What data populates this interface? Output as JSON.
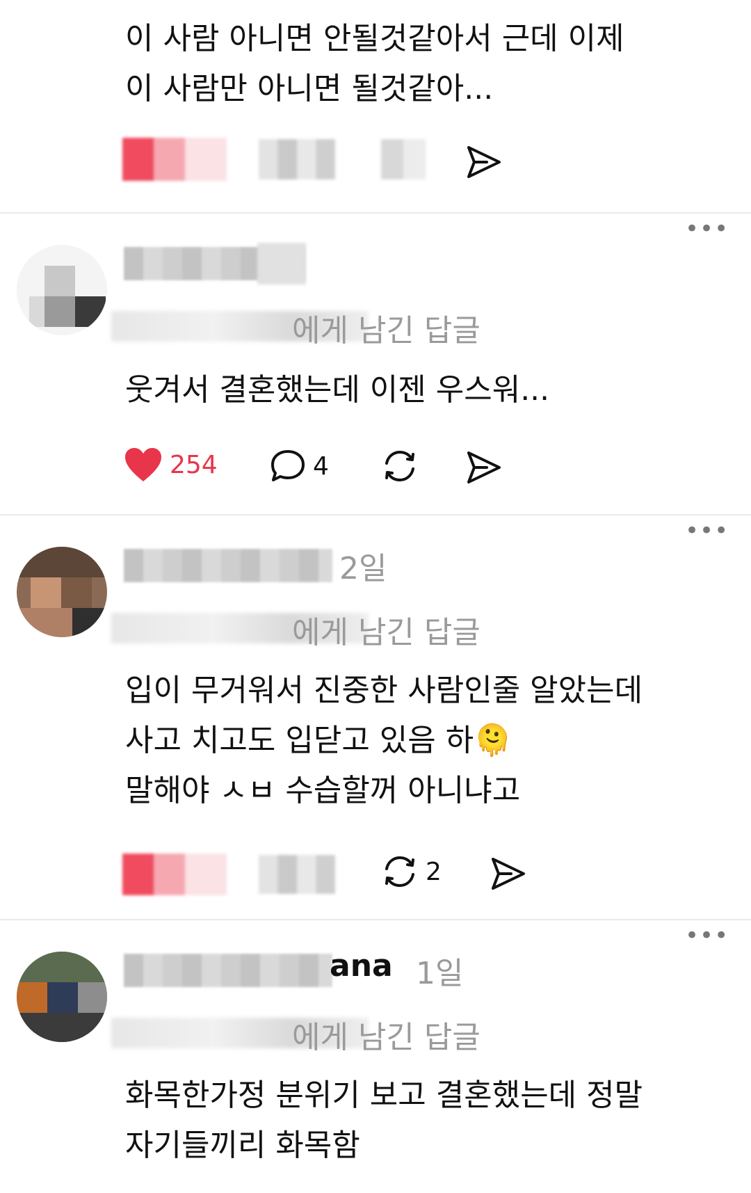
{
  "posts": [
    {
      "body_lines": [
        "이 사람 아니면 안될것같아서 근데 이제",
        "이 사람만 아니면 될것같아..."
      ]
    },
    {
      "reply_suffix": "에게 남긴 답글",
      "body_lines": [
        "웃겨서 결혼했는데 이젠 우스워..."
      ],
      "likes": "254",
      "comments": "4"
    },
    {
      "time": "2일",
      "reply_suffix": "에게 남긴 답글",
      "body_lines": [
        "입이 무거워서 진중한 사람인줄 알았는데",
        "사고 치고도 입닫고 있음 하🫠",
        "말해야 ㅅㅂ 수습할꺼 아니냐고"
      ],
      "reposts": "2"
    },
    {
      "username_suffix": "ana",
      "time": "1일",
      "reply_suffix": "에게 남긴 답글",
      "body_lines": [
        "화목한가정 분위기 보고 결혼했는데 정말",
        "자기들끼리 화목함"
      ]
    }
  ],
  "colors": {
    "like": "#e8354a",
    "divider": "#e9e9e9",
    "muted": "#9a9a9a"
  },
  "icons": [
    "heart-icon",
    "comment-icon",
    "repost-icon",
    "share-icon",
    "more-icon"
  ]
}
